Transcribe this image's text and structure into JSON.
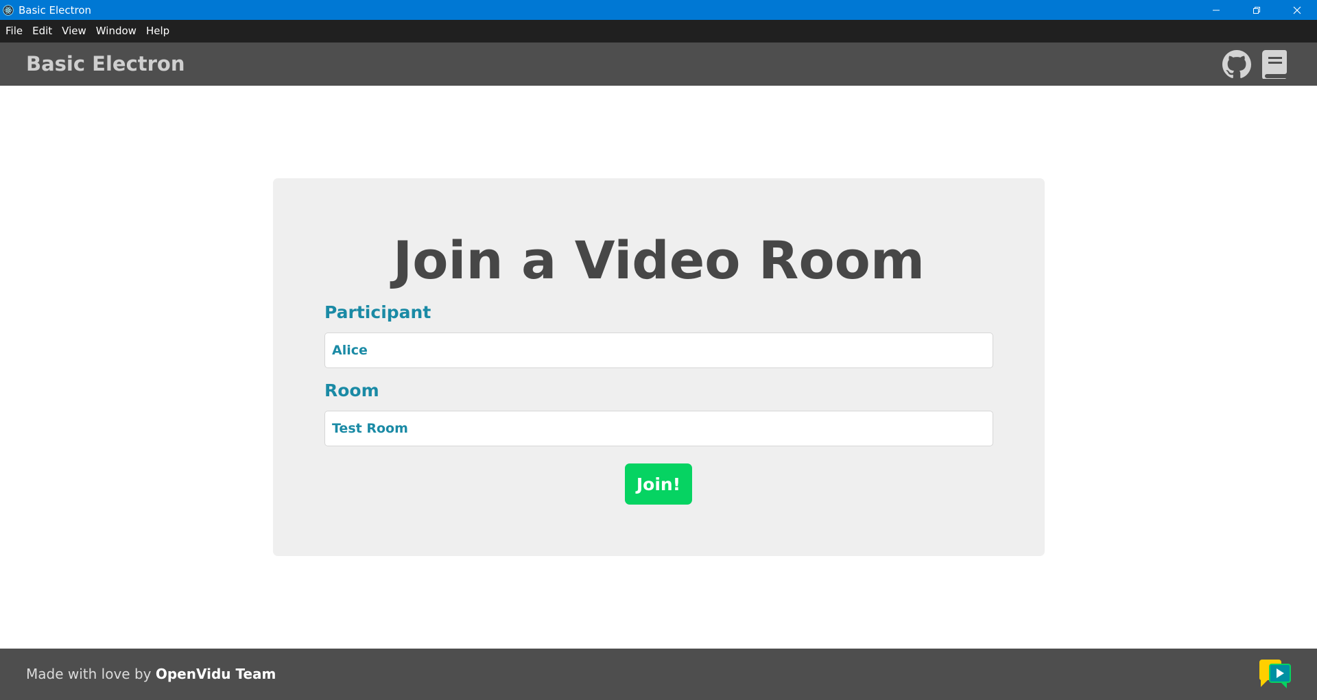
{
  "window": {
    "title": "Basic Electron",
    "icons": {
      "app": "electron-icon",
      "minimize": "minimize-icon",
      "restore": "restore-icon",
      "close": "close-icon"
    }
  },
  "menu": [
    "File",
    "Edit",
    "View",
    "Window",
    "Help"
  ],
  "header": {
    "brand": "Basic Electron",
    "icons": [
      "github-icon",
      "book-icon"
    ]
  },
  "form": {
    "title": "Join a Video Room",
    "participant_label": "Participant",
    "participant_value": "Alice",
    "room_label": "Room",
    "room_value": "Test Room",
    "join_label": "Join!"
  },
  "footer": {
    "prefix": "Made with love by ",
    "team": "OpenVidu Team",
    "logo": "openvidu-logo-icon"
  },
  "colors": {
    "titlebar": "#0078d4",
    "menubar": "#202020",
    "header": "#4e4e4e",
    "accent": "#1a8aa5",
    "join_button": "#06d362",
    "card": "#efefef"
  }
}
